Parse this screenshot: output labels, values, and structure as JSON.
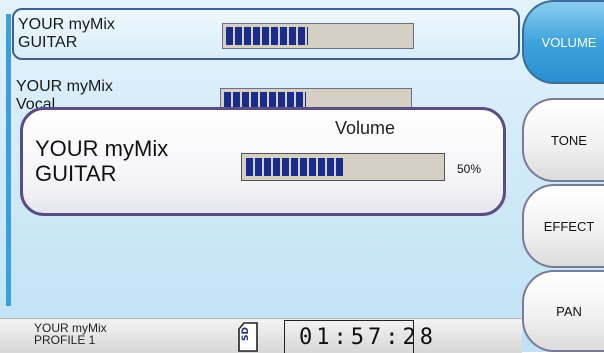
{
  "channels": [
    {
      "name_line1": "YOUR myMix",
      "name_line2": "GUITAR",
      "level": 0.45,
      "selected": true
    },
    {
      "name_line1": "YOUR myMix",
      "name_line2": "Vocal",
      "level": 0.45,
      "selected": false
    }
  ],
  "popup": {
    "title": "Volume",
    "name_line1": "YOUR myMix",
    "name_line2": "GUITAR",
    "level": 0.5,
    "percent_label": "50%"
  },
  "side_menu": [
    {
      "label": "VOLUME",
      "active": true
    },
    {
      "label": "TONE",
      "active": false
    },
    {
      "label": "EFFECT",
      "active": false
    },
    {
      "label": "PAN",
      "active": false
    }
  ],
  "footer": {
    "profile_line1": "YOUR myMix",
    "profile_line2": "PROFILE 1",
    "sd_label": "SD",
    "time": "01:57:28"
  },
  "colors": {
    "accent": "#3aa0dd",
    "meter_fill": "#1b2d8a",
    "active_button": "#3ea3dc",
    "popup_border": "#5a4d86"
  }
}
